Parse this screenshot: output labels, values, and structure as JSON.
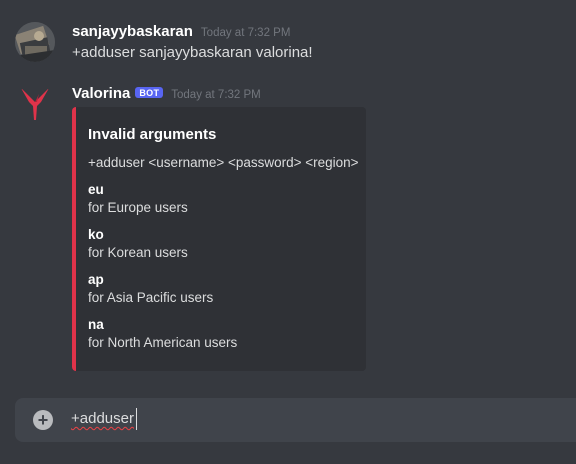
{
  "messages": [
    {
      "author": "sanjayybaskaran",
      "timestamp": "Today at 7:32 PM",
      "content": "+adduser sanjayybaskaran valorina!"
    },
    {
      "author": "Valorina",
      "bot_tag": "BOT",
      "timestamp": "Today at 7:32 PM",
      "embed": {
        "accent_color": "#e0334a",
        "title": "Invalid arguments",
        "description": "+adduser <username> <password> <region>",
        "fields": [
          {
            "name": "eu",
            "value": "for Europe users"
          },
          {
            "name": "ko",
            "value": "for Korean users"
          },
          {
            "name": "ap",
            "value": "for Asia Pacific users"
          },
          {
            "name": "na",
            "value": "for North American users"
          }
        ]
      }
    }
  ],
  "composer": {
    "value": "+adduser",
    "add_icon": "plus-circle-icon"
  }
}
